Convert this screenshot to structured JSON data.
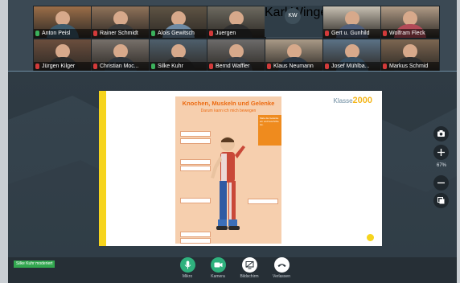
{
  "participants_row1": [
    {
      "name": "Anton Peisl",
      "mic": "on",
      "bg": "#9b6e48",
      "shirt": "#3d5a6b"
    },
    {
      "name": "Rainer Schmidt",
      "mic": "off",
      "bg": "#8f7259",
      "shirt": "#3b3b3b"
    },
    {
      "name": "Alois Gewitsch",
      "mic": "on",
      "bg": "#5f5444",
      "shirt": "#6e8aa4"
    },
    {
      "name": "Juergen",
      "mic": "off",
      "bg": "#6d6a60",
      "shirt": "#2f2f2f"
    },
    {
      "name": "Karl.Wingenfe...",
      "mic": "off",
      "bg": "#2f3d47",
      "shirt": "#2f3d47",
      "initials": "KW"
    },
    {
      "name": "Gert u. Gunhild",
      "mic": "off",
      "bg": "#c7c0b2",
      "shirt": "#4f5e7a"
    },
    {
      "name": "Wolfram Fleck",
      "mic": "off",
      "bg": "#b09b86",
      "shirt": "#b34a58"
    }
  ],
  "participants_row2": [
    {
      "name": "Jürgen Kilger",
      "mic": "off",
      "bg": "#6b4e3d",
      "shirt": "#2b2b2b"
    },
    {
      "name": "Christian Moc...",
      "mic": "off",
      "bg": "#77706a",
      "shirt": "#30363c"
    },
    {
      "name": "Silke Kuhr",
      "mic": "on",
      "bg": "#4e5f6c",
      "shirt": "#2d2d2d"
    },
    {
      "name": "Bernd Waffler",
      "mic": "off",
      "bg": "#6c6b6a",
      "shirt": "#3a3f45"
    },
    {
      "name": "Klaus Neumann",
      "mic": "off",
      "bg": "#a99a87",
      "shirt": "#2e3945"
    },
    {
      "name": "Josef Mühlba...",
      "mic": "off",
      "bg": "#5b7286",
      "shirt": "#385063"
    },
    {
      "name": "Markus Schmid",
      "mic": "off",
      "bg": "#7c6651",
      "shirt": "#2f2f2f"
    }
  ],
  "colors": {
    "mic_on": "#3bb15c",
    "mic_off": "#d33a3a",
    "control_green": "#2fb17d",
    "control_white": "#ffffff"
  },
  "share": {
    "poster_title": "Knochen, Muskeln und Gelenke",
    "poster_subtitle": "Darum kann ich mich bewegen",
    "logo_prefix": "Klasse",
    "logo_number": "2000",
    "note_text": "Male die Gelenke ein und beschrifte sie."
  },
  "side": {
    "zoom": "67%"
  },
  "status": {
    "moderator": "Silke Kuhr moderiert"
  },
  "controls": [
    {
      "label": "Mikro",
      "icon": "microphone-icon",
      "color": "#2fb17d"
    },
    {
      "label": "Kamera",
      "icon": "camera-icon",
      "color": "#2fb17d"
    },
    {
      "label": "Bildschirm",
      "icon": "screen-share-icon",
      "color": "#ffffff"
    },
    {
      "label": "Verlassen",
      "icon": "hangup-icon",
      "color": "#ffffff"
    }
  ]
}
